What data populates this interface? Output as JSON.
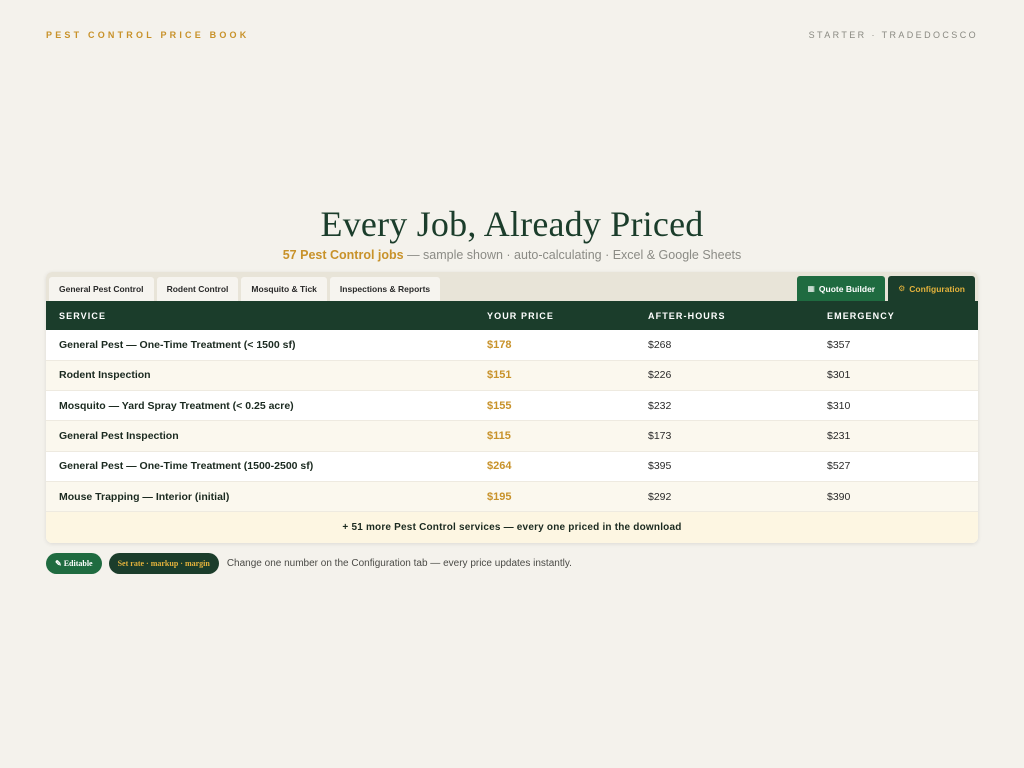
{
  "header": {
    "brand": "PEST CONTROL PRICE BOOK",
    "plan": "STARTER · TRADEDOCSCO"
  },
  "hero": {
    "title": "Every Job, Already Priced",
    "subtitle_highlight": "57 Pest Control jobs",
    "subtitle_rest": " — sample shown · auto-calculating · Excel & Google Sheets"
  },
  "tabs": [
    {
      "label": "General Pest Control"
    },
    {
      "label": "Rodent Control"
    },
    {
      "label": "Mosquito & Tick"
    },
    {
      "label": "Inspections & Reports"
    }
  ],
  "tabs_right": {
    "quote_icon": "▦",
    "quote_label": "Quote Builder",
    "config_icon": "⚙",
    "config_label": "Configuration"
  },
  "table": {
    "columns": [
      "SERVICE",
      "YOUR PRICE",
      "AFTER-HOURS",
      "EMERGENCY"
    ],
    "rows": [
      {
        "service": "General Pest — One-Time Treatment (< 1500 sf)",
        "price": "$178",
        "after_hours": "$268",
        "emergency": "$357"
      },
      {
        "service": "Rodent Inspection",
        "price": "$151",
        "after_hours": "$226",
        "emergency": "$301"
      },
      {
        "service": "Mosquito — Yard Spray Treatment (< 0.25 acre)",
        "price": "$155",
        "after_hours": "$232",
        "emergency": "$310"
      },
      {
        "service": "General Pest Inspection",
        "price": "$115",
        "after_hours": "$173",
        "emergency": "$231"
      },
      {
        "service": "General Pest — One-Time Treatment (1500-2500 sf)",
        "price": "$264",
        "after_hours": "$395",
        "emergency": "$527"
      },
      {
        "service": "Mouse Trapping — Interior (initial)",
        "price": "$195",
        "after_hours": "$292",
        "emergency": "$390"
      }
    ],
    "more_label": "+ 51 more Pest Control services — every one priced in the download"
  },
  "footer": {
    "editable_label": "✎ Editable",
    "rate_label": "Set rate · markup · margin",
    "note": "Change one number on the Configuration tab — every price updates instantly."
  },
  "colors": {
    "accent_gold": "#c8922a",
    "dark_green": "#1b3d2b",
    "button_green": "#1f6b40",
    "background": "#f4f2ec"
  }
}
